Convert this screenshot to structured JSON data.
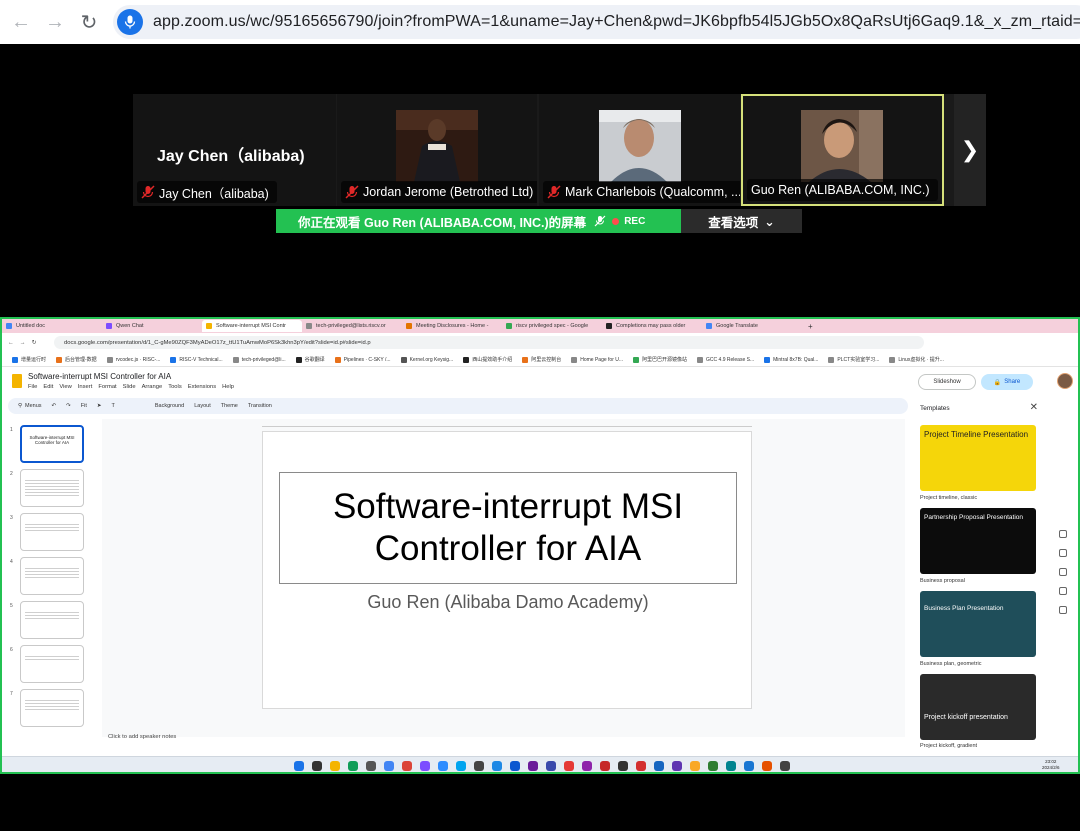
{
  "browser": {
    "url": "app.zoom.us/wc/95165656790/join?fromPWA=1&uname=Jay+Chen&pwd=JK6bpfb54l5JGb5Ox8QaRsUtj6Gaq9.1&_x_zm_rtaid=WJAdxEDpSBeI"
  },
  "participants": [
    {
      "tile_name": "Jay Chen（alibaba)",
      "label": "Jay Chen（alibaba)"
    },
    {
      "label": "Jordan Jerome (Betrothed Ltd)"
    },
    {
      "label": "Mark Charlebois (Qualcomm, ..."
    },
    {
      "label": "Guo Ren (ALIBABA.COM, INC.)"
    }
  ],
  "share_banner": {
    "text": "你正在观看 Guo Ren (ALIBABA.COM, INC.)的屏幕",
    "rec": "REC",
    "view_options": "查看选项"
  },
  "shared": {
    "tabs": [
      "Untitled doc",
      "Qwen Chat",
      "Software-interrupt MSI Contr",
      "tech-privileged@lists.riscv.or",
      "Meeting Disclosures - Home -",
      "riscv privileged spec - Google",
      "Completions may pass older",
      "Google Translate"
    ],
    "address": "docs.google.com/presentation/d/1_C-gMe90ZQF3MyADeO17z_ttU1TuAmwMoP6Sk3khn3pY/edit?slide=id.p#slide=id.p",
    "bookmarks": [
      "增量运行时",
      "后台管理-数据",
      "rvcodec.js · RISC-...",
      "RISC-V Technical...",
      "tech-privileged@li...",
      "谷歌翻译",
      "Pipelines · C-SKY /...",
      "Kernel.org Keysig...",
      "西山提效助手介绍",
      "阿里云控制台",
      "Home Page for U...",
      "阿里巴巴开源镜像站",
      "GCC 4.9 Release S...",
      "Mintral 8x7B: Qual...",
      "PLCT实验室学习...",
      "Linux虚拟化 · 提升..."
    ],
    "doc_title": "Software-interrupt MSI Controller for AIA",
    "menus": [
      "File",
      "Edit",
      "View",
      "Insert",
      "Format",
      "Slide",
      "Arrange",
      "Tools",
      "Extensions",
      "Help"
    ],
    "slideshow": "Slideshow",
    "share": "Share",
    "toolbar": [
      "Menus",
      "Fit",
      "Background",
      "Layout",
      "Theme",
      "Transition"
    ],
    "thumbs": [
      {
        "num": "1",
        "title": "Software-interrupt MSI Controller for AIA"
      },
      {
        "num": "2",
        "title": ""
      },
      {
        "num": "3",
        "title": ""
      },
      {
        "num": "4",
        "title": ""
      },
      {
        "num": "5",
        "title": ""
      },
      {
        "num": "6",
        "title": ""
      },
      {
        "num": "7",
        "title": ""
      }
    ],
    "slide": {
      "title_line1": "Software-interrupt MSI",
      "title_line2": "Controller for AIA",
      "subtitle": "Guo Ren (Alibaba Damo Academy)"
    },
    "notes": "Click to add speaker notes",
    "templates": {
      "header": "Templates",
      "items": [
        {
          "text": "Project Timeline Presentation",
          "label": "Project timeline, classic",
          "bg": "#f5d60a",
          "fg": "#222"
        },
        {
          "text": "Partnership Proposal Presentation",
          "label": "Business proposal",
          "bg": "#0c0c0c",
          "fg": "#fff"
        },
        {
          "text": "Business Plan Presentation",
          "label": "Business plan, geometric",
          "bg": "#1f4e5a",
          "fg": "#fff"
        },
        {
          "text": "Project kickoff presentation",
          "label": "Project kickoff, gradient",
          "bg": "#2a2a2a",
          "fg": "#fff"
        }
      ]
    },
    "clock": {
      "time": "23:02",
      "date": "2024/2/6"
    }
  },
  "colors": {
    "zoom_green": "#23c152",
    "active_border": "#d5e07a"
  }
}
